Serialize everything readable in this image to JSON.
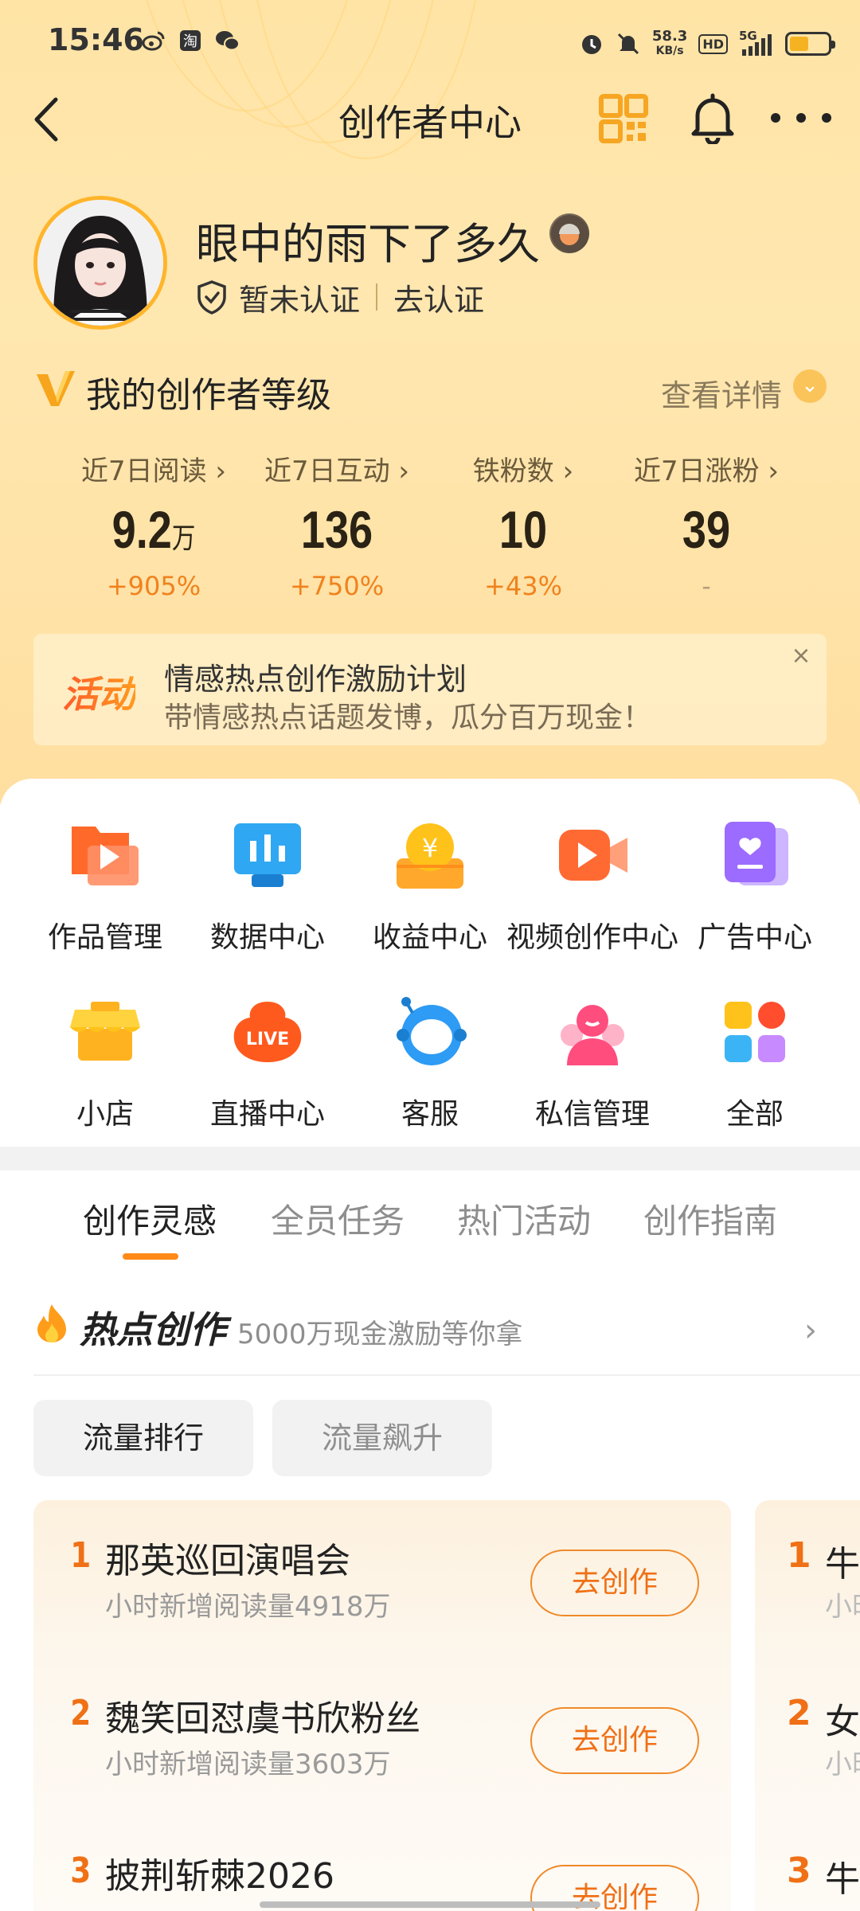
{
  "status_bar": {
    "time": "15:46",
    "speed_value": "58.3",
    "speed_unit": "KB/s",
    "network_hd": "HD",
    "network_gen": "5G",
    "icons": [
      "weibo-icon",
      "taobao-icon",
      "wechat-icon",
      "alarm-icon",
      "mute-icon",
      "signal-icon",
      "battery-icon"
    ]
  },
  "nav": {
    "title": "创作者中心",
    "icons": [
      "back-icon",
      "qr-code-icon",
      "bell-icon",
      "more-icon"
    ]
  },
  "profile": {
    "username": "眼中的雨下了多久",
    "verify_status": "暂未认证",
    "verify_action": "去认证"
  },
  "level": {
    "title": "我的创作者等级",
    "detail": "查看详情"
  },
  "stats": [
    {
      "label": "近7日阅读 ›",
      "value": "9.2",
      "unit": "万",
      "change": "+905%"
    },
    {
      "label": "近7日互动 ›",
      "value": "136",
      "unit": "",
      "change": "+750%"
    },
    {
      "label": "铁粉数 ›",
      "value": "10",
      "unit": "",
      "change": "+43%"
    },
    {
      "label": "近7日涨粉 ›",
      "value": "39",
      "unit": "",
      "change": "-"
    }
  ],
  "banner": {
    "tag": "活动",
    "title": "情感热点创作激励计划",
    "subtitle": "带情感热点话题发博，瓜分百万现金！",
    "close": "×"
  },
  "tools": [
    {
      "label": "作品管理",
      "icon": "works-icon"
    },
    {
      "label": "数据中心",
      "icon": "data-icon"
    },
    {
      "label": "收益中心",
      "icon": "earnings-icon"
    },
    {
      "label": "视频创作中心",
      "icon": "video-icon"
    },
    {
      "label": "广告中心",
      "icon": "ad-icon"
    },
    {
      "label": "小店",
      "icon": "shop-icon"
    },
    {
      "label": "直播中心",
      "icon": "live-icon"
    },
    {
      "label": "客服",
      "icon": "service-icon"
    },
    {
      "label": "私信管理",
      "icon": "message-icon"
    },
    {
      "label": "全部",
      "icon": "all-icon"
    }
  ],
  "tabs": [
    "创作灵感",
    "全员任务",
    "热门活动",
    "创作指南"
  ],
  "active_tab": "创作灵感",
  "hot": {
    "title": "热点创作",
    "subtitle": "5000万现金激励等你拿"
  },
  "filters": [
    "流量排行",
    "流量飙升"
  ],
  "active_filter": "流量排行",
  "ranks": [
    {
      "num": "1",
      "title": "那英巡回演唱会",
      "meta": "小时新增阅读量4918万",
      "action": "去创作"
    },
    {
      "num": "2",
      "title": "魏笑回怼虞书欣粉丝",
      "meta": "小时新增阅读量3603万",
      "action": "去创作"
    },
    {
      "num": "3",
      "title": "披荆斩棘2026",
      "meta": "",
      "action": "去创作"
    }
  ],
  "ranks_peek": [
    {
      "num": "1",
      "char": "牛",
      "sub": "小时"
    },
    {
      "num": "2",
      "char": "女",
      "sub": "小时"
    },
    {
      "num": "3",
      "char": "牛",
      "sub": ""
    }
  ],
  "colors": {
    "accent": "#ff8a18",
    "rank": "#f07016",
    "header_bg": "#ffe4a6"
  }
}
